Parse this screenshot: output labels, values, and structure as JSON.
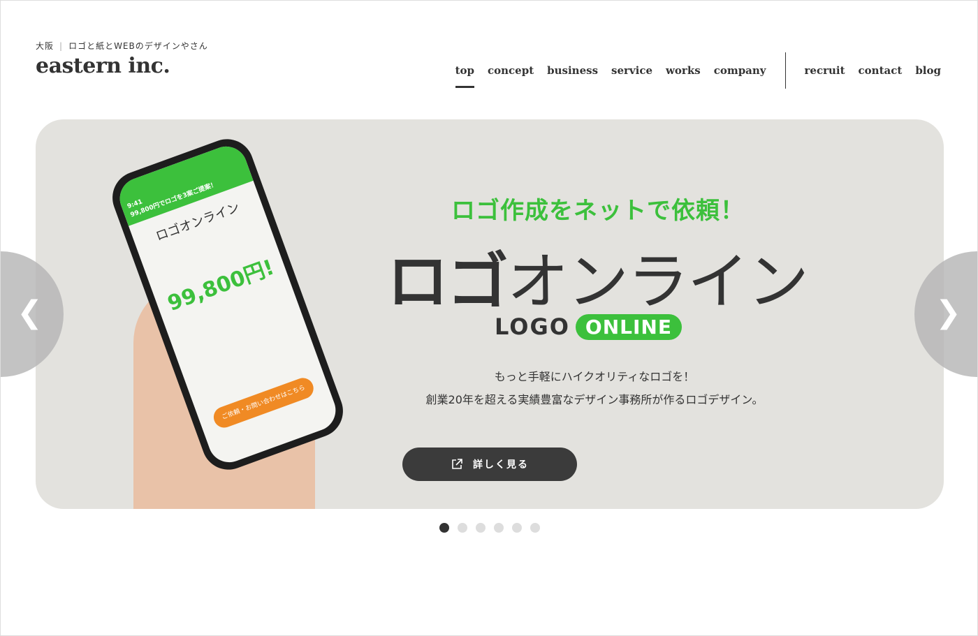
{
  "header": {
    "region": "大阪",
    "tagline": "ロゴと紙とWEBのデザインやさん",
    "logo": "eastern inc."
  },
  "nav": {
    "primary": [
      "top",
      "concept",
      "business",
      "service",
      "works",
      "company"
    ],
    "secondary": [
      "recruit",
      "contact",
      "blog"
    ],
    "active": "top"
  },
  "hero": {
    "catch": "ロゴ作成をネットで依頼！",
    "title_bold": "ロゴ",
    "title_light": "オンライン",
    "logo_text": "LOGO",
    "logo_badge": "ONLINE",
    "desc_lines": [
      "もっと手軽にハイクオリティなロゴを！",
      "創業20年を超える実績豊富なデザイン事務所が作るロゴデザイン。"
    ],
    "button_label": "詳しく見る",
    "button_icon": "external-link-icon",
    "phone": {
      "time": "9:41",
      "banner": "99,800円でロゴを3案ご提案！",
      "product": "ロゴオンライン",
      "price": "99,800円!",
      "cta": "ご依頼・お問い合わせはこちら"
    },
    "accent": "#3cc03c"
  },
  "carousel": {
    "slides": 6,
    "current": 1,
    "prev_icon": "chevron-left-icon",
    "next_icon": "chevron-right-icon"
  }
}
